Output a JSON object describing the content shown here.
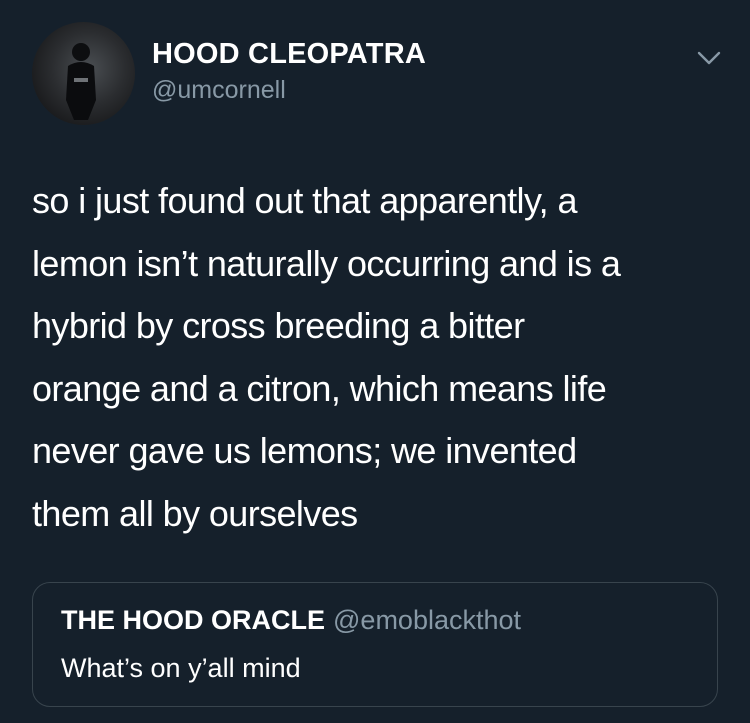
{
  "author": {
    "display_name": "HOOD CLEOPATRA",
    "handle": "@umcornell",
    "avatar": "profile-photo"
  },
  "tweet": {
    "text": "so i just found out that apparently, a\nlemon isn’t naturally occurring and is a\nhybrid by cross breeding a bitter\norange and a citron, which means life\nnever gave us lemons; we invented\nthem all by ourselves"
  },
  "quoted_tweet": {
    "display_name": "THE HOOD ORACLE",
    "handle": "@emoblackthot",
    "text": "What’s on y’all mind"
  },
  "icons": {
    "menu": "chevron-down-icon"
  },
  "colors": {
    "background": "#15202b",
    "primary_text": "#ffffff",
    "secondary_text": "#8899a6",
    "border": "#38444d"
  }
}
